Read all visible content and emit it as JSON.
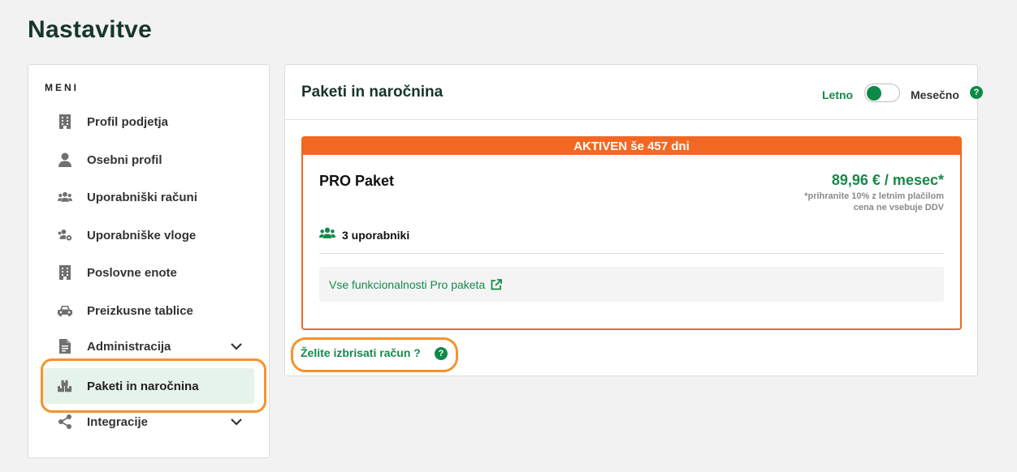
{
  "page": {
    "title": "Nastavitve"
  },
  "sidebar": {
    "heading": "MENI",
    "items": [
      {
        "label": "Profil podjetja",
        "icon": "building-icon"
      },
      {
        "label": "Osebni profil",
        "icon": "user-icon"
      },
      {
        "label": "Uporabniški računi",
        "icon": "users-icon"
      },
      {
        "label": "Uporabniške vloge",
        "icon": "users-cog-icon"
      },
      {
        "label": "Poslovne enote",
        "icon": "building-icon"
      },
      {
        "label": "Preizkusne tablice",
        "icon": "car-icon"
      },
      {
        "label": "Administracija",
        "icon": "document-icon",
        "expandable": true
      },
      {
        "label": "Paketi in naročnina",
        "icon": "boxes-icon",
        "active": true
      },
      {
        "label": "Integracije",
        "icon": "share-icon",
        "expandable": true
      }
    ]
  },
  "subscription": {
    "title": "Paketi in naročnina",
    "billing_toggle": {
      "left_label": "Letno",
      "right_label": "Mesečno",
      "selected": "Letno"
    },
    "package": {
      "status_banner": "AKTIVEN še  457 dni",
      "name": "PRO Paket",
      "price": "89,96 € / mesec*",
      "note_line1": "*prihranite 10% z letnim plačilom",
      "note_line2": "cena ne vsebuje DDV",
      "users": "3 uporabniki",
      "features_link": "Vse funkcionalnosti Pro paketa"
    },
    "delete_account": "Želite izbrisati račun ?"
  },
  "colors": {
    "accent_green": "#16894a",
    "banner_orange": "#f26822",
    "highlight_orange": "#f7922b",
    "title_dark": "#17352c"
  }
}
